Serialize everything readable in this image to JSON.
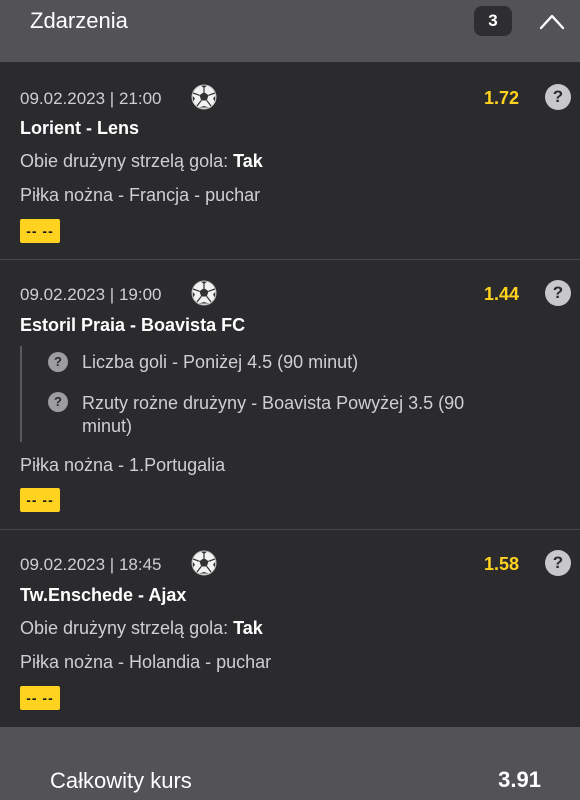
{
  "header": {
    "title": "Zdarzenia",
    "count": "3"
  },
  "events": [
    {
      "date": "09.02.2023 | 21:00",
      "teams": "Lorient - Lens",
      "odds": "1.72",
      "market_label": "Obie drużyny strzelą gola:",
      "market_value": "Tak",
      "league": "Piłka nożna - Francja - puchar",
      "score": "-- --"
    },
    {
      "date": "09.02.2023 | 19:00",
      "teams": "Estoril Praia - Boavista FC",
      "odds": "1.44",
      "selections": [
        "Liczba goli - Poniżej 4.5 (90 minut)",
        "Rzuty rożne drużyny - Boavista Powyżej 3.5 (90 minut)"
      ],
      "league": "Piłka nożna - 1.Portugalia",
      "score": "-- --"
    },
    {
      "date": "09.02.2023 | 18:45",
      "teams": "Tw.Enschede - Ajax",
      "odds": "1.58",
      "market_label": "Obie drużyny strzelą gola:",
      "market_value": "Tak",
      "league": "Piłka nożna - Holandia - puchar",
      "score": "-- --"
    }
  ],
  "help_symbol": "?",
  "footer": {
    "total_label": "Całkowity kurs",
    "total_value": "3.91"
  },
  "colors": {
    "accent": "#ffd21f",
    "background": "#2b2b2e",
    "header": "#525257"
  },
  "icons": {
    "sport": "soccer-ball-icon",
    "collapse": "chevron-up-icon",
    "help": "help-icon"
  }
}
